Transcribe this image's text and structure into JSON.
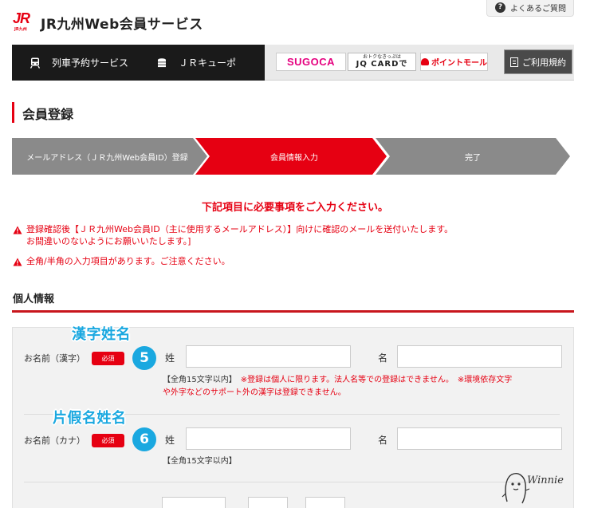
{
  "header": {
    "logo_text": "JR",
    "logo_sub": "JR九州",
    "site_title": "JR九州Web会員サービス",
    "faq_label": "よくあるご質問"
  },
  "nav": {
    "items": [
      {
        "label": "列車予約サービス",
        "icon": "train-icon"
      },
      {
        "label": "ＪＲキューポ",
        "icon": "coin-stack-icon"
      }
    ],
    "sugoca_label": "SUGOCA",
    "jqcard_small": "おトクなきっぷは",
    "jqcard_label": "JQ CARDで",
    "point_mall_label": "ポイントモール",
    "terms_label": "ご利用規約"
  },
  "page": {
    "title": "会員登録"
  },
  "steps": [
    {
      "label": "メールアドレス（ＪＲ九州Web会員ID）登録",
      "state": "done"
    },
    {
      "label": "会員情報入力",
      "state": "active"
    },
    {
      "label": "完了",
      "state": "pending"
    }
  ],
  "notices": {
    "main": "下記項目に必要事項をご入力ください。",
    "warning_1_line_1": "登録確認後【ＪＲ九州Web会員ID（主に使用するメールアドレス）】向けに確認のメールを送付いたします。",
    "warning_1_line_2": "お間違いのないようにお願いいたします。]",
    "warning_2": "全角/半角の入力項目があります。ご注意ください。"
  },
  "section": {
    "heading": "個人情報"
  },
  "form": {
    "required_badge": "必須",
    "rows": [
      {
        "label": "お名前（漢字）",
        "number": "5",
        "annotation": "漢字姓名",
        "last_label": "姓",
        "first_label": "名",
        "last_value": "",
        "first_value": "",
        "hint_black": "【全角15文字以内】",
        "hint_red_1": "※登録は個人に限ります。法人名等での登録はできません。",
        "hint_red_2": "※環境依存文字",
        "hint_red_3": "や外字などのサポート外の漢字は登録できません。"
      },
      {
        "label": "お名前（カナ）",
        "number": "6",
        "annotation": "片假名姓名",
        "last_label": "姓",
        "first_label": "名",
        "last_value": "",
        "first_value": "",
        "hint_black": "【全角15文字以内】"
      }
    ]
  },
  "watermark": {
    "text": "Winnie"
  },
  "colors": {
    "brand_red": "#e60012",
    "step_gray": "#8a8a8a",
    "annotation_blue": "#1aa8e0",
    "nav_dark": "#1a1a1a"
  }
}
